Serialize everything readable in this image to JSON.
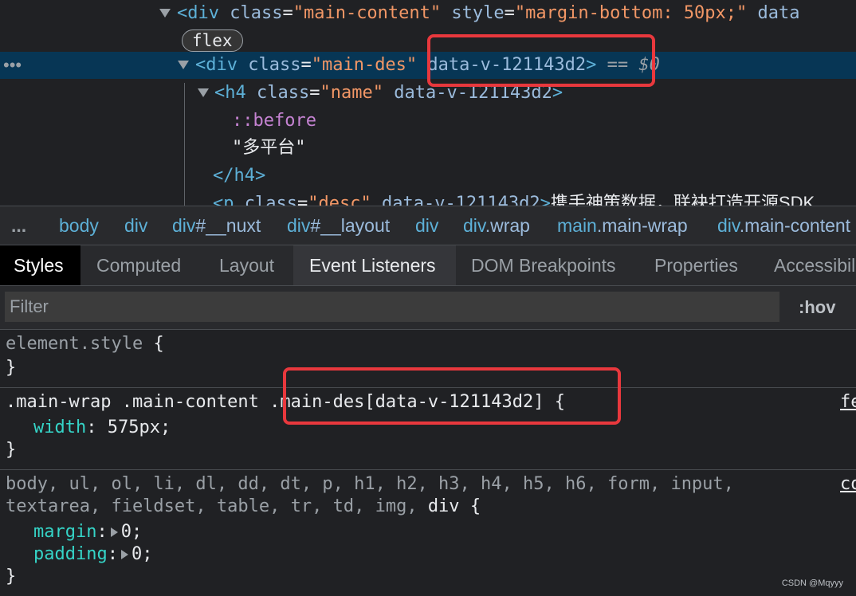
{
  "elements": {
    "line1": {
      "open": "<div",
      "class_attr": "class",
      "class_val": "\"main-content\"",
      "style_attr": "style",
      "style_val": "\"margin-bottom: 50px;\"",
      "trail": "data"
    },
    "badge": "flex",
    "line3": {
      "open": "<div",
      "class_attr": "class",
      "class_val": "\"main-des\"",
      "data_attr": "data-v-121143d2",
      "close": ">",
      "eq": " == $0"
    },
    "line4": {
      "open": "<h4",
      "class_attr": "class",
      "class_val": "\"name\"",
      "data_attr": "data-v-121143d2",
      "close": ">"
    },
    "pseudo": "::before",
    "text": "\"多平台\"",
    "close_h4": "</h4>",
    "line8": {
      "open": "<p",
      "class_attr": "class",
      "class_val": "\"desc\"",
      "data_attr": "data-v-121143d2",
      "close": ">",
      "text": "携手神策数据，联袂打造开源SDK"
    }
  },
  "breadcrumb": {
    "more": "...",
    "items": [
      {
        "tag": "body",
        "rest": ""
      },
      {
        "tag": "div",
        "rest": ""
      },
      {
        "tag": "div",
        "rest": "#__nuxt"
      },
      {
        "tag": "div",
        "rest": "#__layout"
      },
      {
        "tag": "div",
        "rest": ""
      },
      {
        "tag": "div",
        "rest": ".wrap"
      },
      {
        "tag": "main",
        "rest": ".main-wrap"
      },
      {
        "tag": "div",
        "rest": ".main-content"
      }
    ]
  },
  "tabs": [
    "Styles",
    "Computed",
    "Layout",
    "Event Listeners",
    "DOM Breakpoints",
    "Properties",
    "Accessibility"
  ],
  "filter": {
    "placeholder": "Filter",
    "hov": ":hov"
  },
  "styles": {
    "element_style": {
      "selector": "element.style",
      "open": "{",
      "close": "}"
    },
    "rule1": {
      "selector_gray": ".main-wrap .main-content",
      "selector_match": ".main-des[data-v-121143d2]",
      "open": "{",
      "prop": "width",
      "value": "575px;",
      "close": "}",
      "source": "fe"
    },
    "rule2": {
      "selector_line1": "body, ul, ol, li, dl, dd, dt, p, h1, h2, h3, h4, h5, h6, form, input,",
      "selector_line2_gray": "textarea, fieldset, table, tr, td, img,",
      "selector_line2_match": "div",
      "open": "{",
      "source": "co",
      "props": [
        {
          "name": "margin",
          "value": "0;"
        },
        {
          "name": "padding",
          "value": "0;"
        }
      ],
      "close": "}"
    }
  },
  "watermark": "CSDN @Mqyyy",
  "colors": {
    "highlight_border": "#e8383d",
    "selected_row": "#073655"
  }
}
